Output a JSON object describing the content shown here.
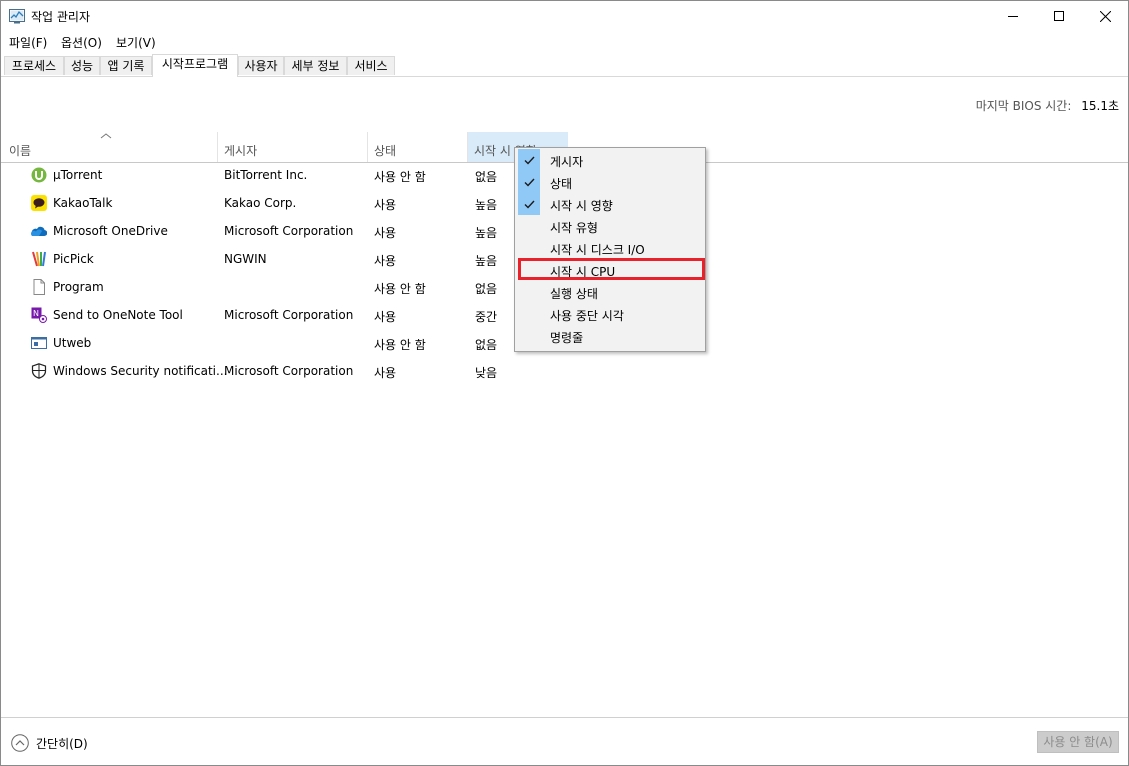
{
  "window": {
    "title": "작업 관리자",
    "minimize_icon": "minimize-icon",
    "maximize_icon": "maximize-icon",
    "close_icon": "close-icon"
  },
  "menu": [
    {
      "label": "파일(F)"
    },
    {
      "label": "옵션(O)"
    },
    {
      "label": "보기(V)"
    }
  ],
  "tabs": [
    {
      "label": "프로세스"
    },
    {
      "label": "성능"
    },
    {
      "label": "앱 기록"
    },
    {
      "label": "시작프로그램"
    },
    {
      "label": "사용자"
    },
    {
      "label": "세부 정보"
    },
    {
      "label": "서비스"
    }
  ],
  "active_tab": "시작프로그램",
  "bios": {
    "label": "마지막 BIOS 시간:",
    "value": "15.1초"
  },
  "columns": {
    "name": "이름",
    "publisher": "게시자",
    "status": "상태",
    "impact": "시작 시 영향"
  },
  "rows": [
    {
      "name": "µTorrent",
      "publisher": "BitTorrent Inc.",
      "status": "사용 안 함",
      "impact": "없음",
      "icon": "utorrent-icon"
    },
    {
      "name": "KakaoTalk",
      "publisher": "Kakao Corp.",
      "status": "사용",
      "impact": "높음",
      "icon": "kakaotalk-icon"
    },
    {
      "name": "Microsoft OneDrive",
      "publisher": "Microsoft Corporation",
      "status": "사용",
      "impact": "높음",
      "icon": "onedrive-icon"
    },
    {
      "name": "PicPick",
      "publisher": "NGWIN",
      "status": "사용",
      "impact": "높음",
      "icon": "picpick-icon"
    },
    {
      "name": "Program",
      "publisher": "",
      "status": "사용 안 함",
      "impact": "없음",
      "icon": "file-icon"
    },
    {
      "name": "Send to OneNote Tool",
      "publisher": "Microsoft Corporation",
      "status": "사용",
      "impact": "중간",
      "icon": "onenote-icon"
    },
    {
      "name": "Utweb",
      "publisher": "",
      "status": "사용 안 함",
      "impact": "없음",
      "icon": "utweb-icon"
    },
    {
      "name": "Windows Security notificati...",
      "publisher": "Microsoft Corporation",
      "status": "사용",
      "impact": "낮음",
      "icon": "shield-icon"
    }
  ],
  "context_menu": [
    {
      "label": "게시자",
      "checked": true
    },
    {
      "label": "상태",
      "checked": true
    },
    {
      "label": "시작 시 영향",
      "checked": true
    },
    {
      "label": "시작 유형",
      "checked": false
    },
    {
      "label": "시작 시 디스크 I/O",
      "checked": false
    },
    {
      "label": "시작 시 CPU",
      "checked": false,
      "highlighted": true
    },
    {
      "label": "실행 상태",
      "checked": false
    },
    {
      "label": "사용 중단 시각",
      "checked": false
    },
    {
      "label": "명령줄",
      "checked": false
    }
  ],
  "footer": {
    "fewer_details": "간단히(D)",
    "disable_button": "사용 안 함(A)"
  },
  "colors": {
    "highlight_border": "#e8212a",
    "check_bg": "#90c8f6",
    "selected_header": "#d9ebf9"
  }
}
